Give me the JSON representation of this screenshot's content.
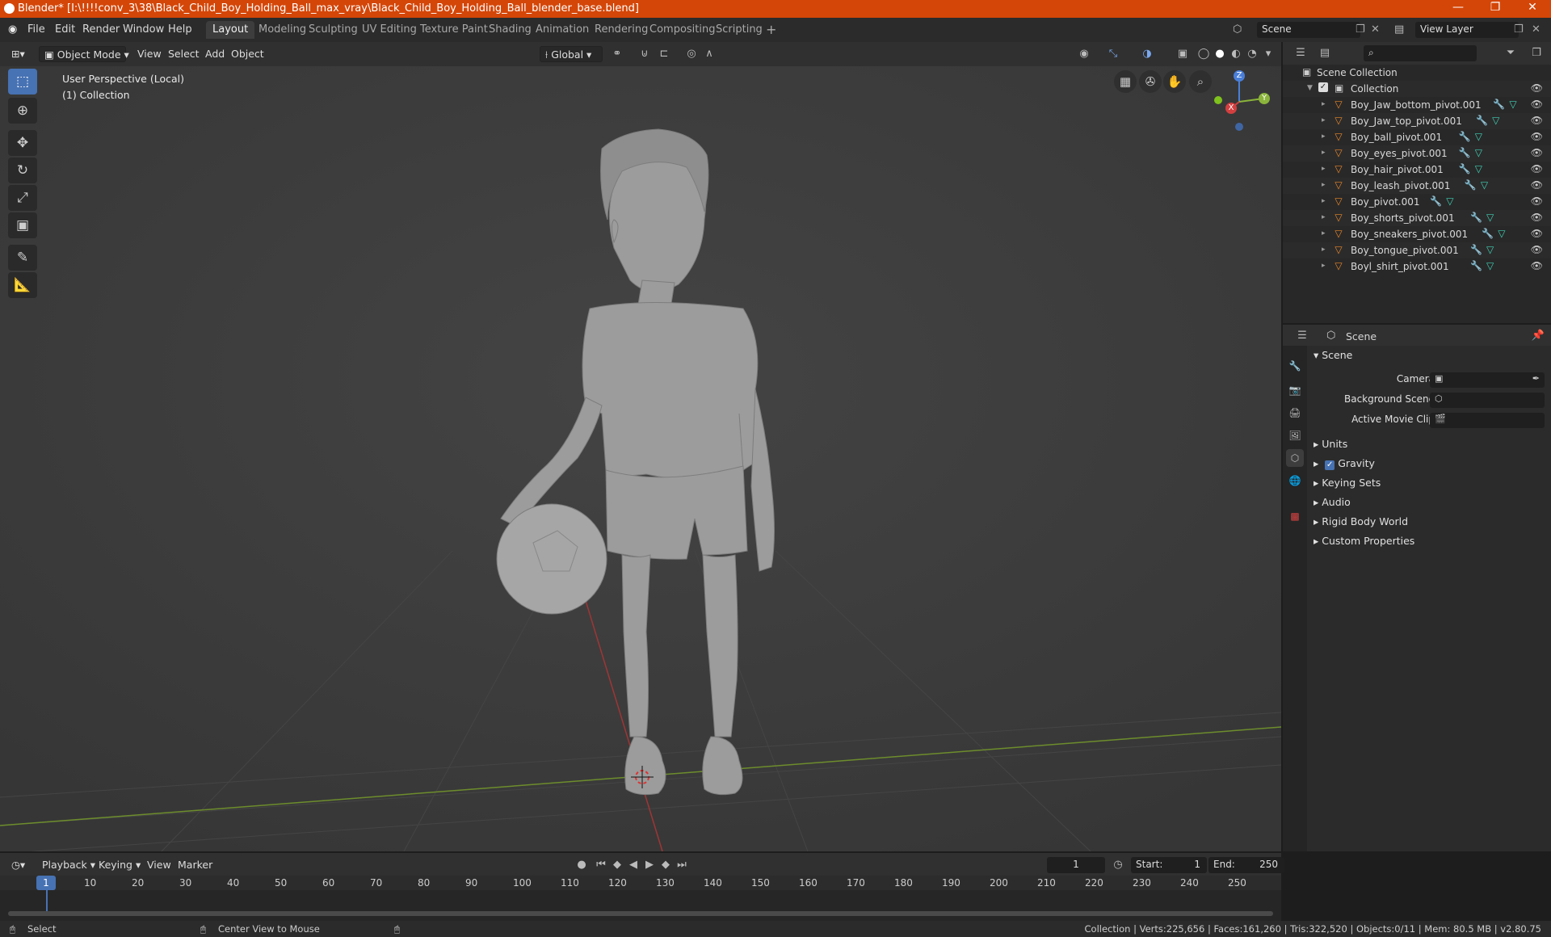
{
  "window": {
    "title": "Blender* [I:\\!!!!conv_3\\38\\Black_Child_Boy_Holding_Ball_max_vray\\Black_Child_Boy_Holding_Ball_blender_base.blend]",
    "minimize": "—",
    "maximize": "❐",
    "close": "✕"
  },
  "menu": {
    "file": "File",
    "edit": "Edit",
    "render": "Render",
    "window": "Window",
    "help": "Help"
  },
  "workspaces": [
    "Layout",
    "Modeling",
    "Sculpting",
    "UV Editing",
    "Texture Paint",
    "Shading",
    "Animation",
    "Rendering",
    "Compositing",
    "Scripting"
  ],
  "scene_field": "Scene",
  "view_layer_field": "View Layer",
  "viewport_header": {
    "mode": "Object Mode",
    "view": "View",
    "select": "Select",
    "add": "Add",
    "object": "Object",
    "transform_orientation": "Global"
  },
  "viewport_info": {
    "perspective": "User Perspective (Local)",
    "collection": "(1) Collection"
  },
  "gizmo": {
    "z": "Z",
    "x": "X",
    "y": "Y"
  },
  "outliner": {
    "root": "Scene Collection",
    "collection": "Collection",
    "objects": [
      "Boy_Jaw_bottom_pivot.001",
      "Boy_Jaw_top_pivot.001",
      "Boy_ball_pivot.001",
      "Boy_eyes_pivot.001",
      "Boy_hair_pivot.001",
      "Boy_leash_pivot.001",
      "Boy_pivot.001",
      "Boy_shorts_pivot.001",
      "Boy_sneakers_pivot.001",
      "Boy_tongue_pivot.001",
      "Boyl_shirt_pivot.001"
    ]
  },
  "properties": {
    "context": "Scene",
    "panel_title": "Scene",
    "camera_label": "Camera",
    "background_scene_label": "Background Scene",
    "active_movie_clip_label": "Active Movie Clip",
    "sections": [
      "Units",
      "Gravity",
      "Keying Sets",
      "Audio",
      "Rigid Body World",
      "Custom Properties"
    ]
  },
  "timeline": {
    "playback": "Playback",
    "keying": "Keying",
    "view": "View",
    "marker": "Marker",
    "current_frame": "1",
    "start_label": "Start:",
    "start": "1",
    "end_label": "End:",
    "end": "250",
    "ticks": [
      "10",
      "20",
      "30",
      "40",
      "50",
      "60",
      "70",
      "80",
      "90",
      "100",
      "110",
      "120",
      "130",
      "140",
      "150",
      "160",
      "170",
      "180",
      "190",
      "200",
      "210",
      "220",
      "230",
      "240",
      "250"
    ],
    "playhead": "1"
  },
  "status": {
    "left": "Select",
    "middle": "Center View to Mouse",
    "right": "Collection | Verts:225,656 | Faces:161,260 | Tris:322,520 | Objects:0/11 | Mem: 80.5 MB | v2.80.75"
  }
}
